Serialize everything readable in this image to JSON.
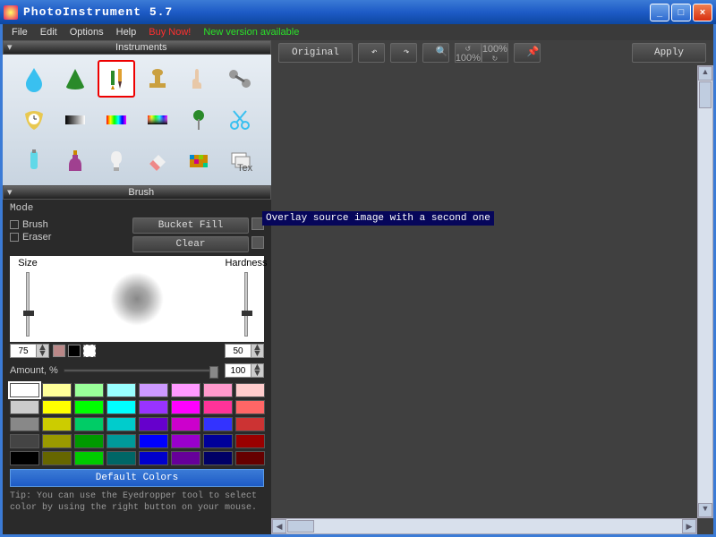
{
  "window": {
    "title": "PhotoInstrument 5.7"
  },
  "menu": {
    "items": [
      "File",
      "Edit",
      "Options",
      "Help"
    ],
    "buy": "Buy Now!",
    "newver": "New version available"
  },
  "panels": {
    "instruments_title": "Instruments",
    "brush_title": "Brush"
  },
  "tools": [
    "drop-icon",
    "cone-icon",
    "brush-pencil-icon",
    "stamp-icon",
    "finger-icon",
    "dumbbell-icon",
    "clock-icon",
    "gradient-icon",
    "rainbow-icon",
    "spectrum-icon",
    "pin-icon",
    "scissors-icon",
    "tube-icon",
    "bottle-icon",
    "bulb-icon",
    "eraser-icon",
    "mosaic-icon",
    "layers-text-icon"
  ],
  "tool_selected_index": 2,
  "tooltip": "Overlay source image with a second one",
  "brush": {
    "mode_label": "Mode",
    "mode_brush": "Brush",
    "mode_eraser": "Eraser",
    "bucket_fill": "Bucket Fill",
    "clear": "Clear",
    "size_label": "Size",
    "hardness_label": "Hardness",
    "size_value": "75",
    "hardness_value": "50",
    "amount_label": "Amount, %",
    "amount_value": "100"
  },
  "palette": [
    "#ffffff",
    "#ffff99",
    "#99ff99",
    "#99ffff",
    "#cc99ff",
    "#ff99ff",
    "#ff99cc",
    "#ffcccc",
    "#cccccc",
    "#ffff00",
    "#00ff00",
    "#00ffff",
    "#9933ff",
    "#ff00ff",
    "#ff3399",
    "#ff6666",
    "#888888",
    "#cccc00",
    "#00cc66",
    "#00cccc",
    "#6600cc",
    "#cc00cc",
    "#3333ff",
    "#cc3333",
    "#444444",
    "#999900",
    "#009900",
    "#009999",
    "#0000ff",
    "#9900cc",
    "#000099",
    "#990000",
    "#000000",
    "#666600",
    "#00cc00",
    "#006666",
    "#0000cc",
    "#660099",
    "#000066",
    "#660000"
  ],
  "palette_selected": 0,
  "default_colors": "Default Colors",
  "tip": "Tip: You can use the Eyedropper tool to select color by using the right button on your mouse.",
  "toolbar": {
    "original": "Original",
    "apply": "Apply",
    "zoom": "100%"
  }
}
